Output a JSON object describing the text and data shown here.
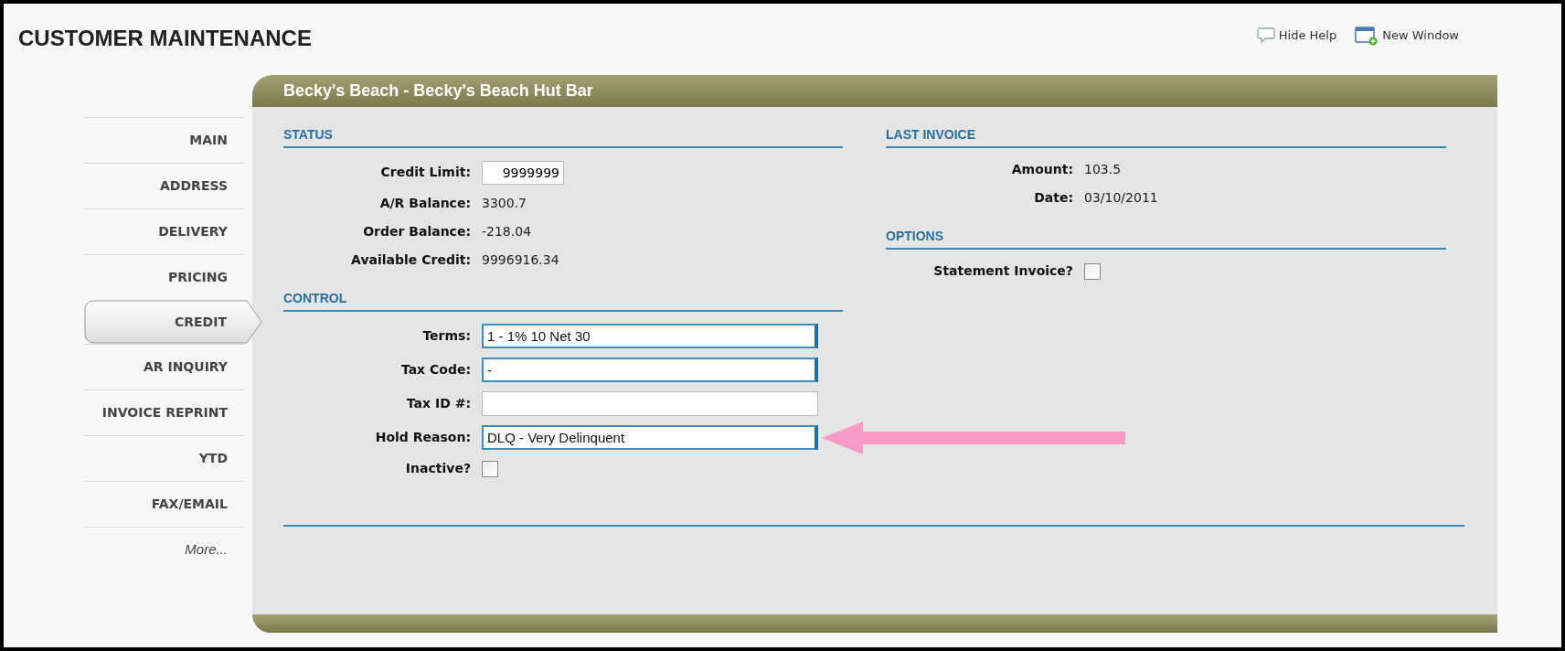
{
  "page": {
    "title": "CUSTOMER MAINTENANCE"
  },
  "links": [
    {
      "kind": "help",
      "label": "Hide Help"
    },
    {
      "kind": "window",
      "label": "New Window"
    }
  ],
  "sidebar": {
    "items": [
      {
        "label": "MAIN",
        "selected": false
      },
      {
        "label": "ADDRESS",
        "selected": false
      },
      {
        "label": "DELIVERY",
        "selected": false
      },
      {
        "label": "PRICING",
        "selected": false
      },
      {
        "label": "CREDIT",
        "selected": true
      },
      {
        "label": "AR INQUIRY",
        "selected": false
      },
      {
        "label": "INVOICE REPRINT",
        "selected": false
      },
      {
        "label": "YTD",
        "selected": false
      },
      {
        "label": "FAX/EMAIL",
        "selected": false
      }
    ],
    "more": "More..."
  },
  "panel": {
    "title": "Becky's Beach - Becky's Beach Hut Bar"
  },
  "left_sections": [
    {
      "heading": "STATUS",
      "fields": [
        {
          "kind": "number",
          "label": "Credit Limit:",
          "value": "9999999"
        },
        {
          "kind": "text",
          "label": "A/R Balance:",
          "value": "3300.7"
        },
        {
          "kind": "text",
          "label": "Order Balance:",
          "value": "-218.04"
        },
        {
          "kind": "text",
          "label": "Available Credit:",
          "value": "9996916.34"
        }
      ]
    },
    {
      "heading": "CONTROL",
      "fields": [
        {
          "kind": "lookup",
          "label": "Terms:",
          "value": "1 - 1% 10 Net 30"
        },
        {
          "kind": "lookup",
          "label": "Tax Code:",
          "value": "-"
        },
        {
          "kind": "input",
          "label": "Tax ID #:"
        },
        {
          "kind": "lookup",
          "label": "Hold Reason:",
          "value": "DLQ - Very Delinquent",
          "pointer": true
        },
        {
          "kind": "checkbox",
          "label": "Inactive?",
          "checked": false
        }
      ]
    }
  ],
  "right_sections": [
    {
      "heading": "LAST INVOICE",
      "fields": [
        {
          "kind": "text",
          "label": "Amount:",
          "value": "103.5"
        },
        {
          "kind": "text",
          "label": "Date:",
          "value": "03/10/2011"
        }
      ]
    },
    {
      "heading": "OPTIONS",
      "fields": [
        {
          "kind": "checkbox",
          "label": "Statement Invoice?",
          "checked": false
        }
      ]
    }
  ]
}
